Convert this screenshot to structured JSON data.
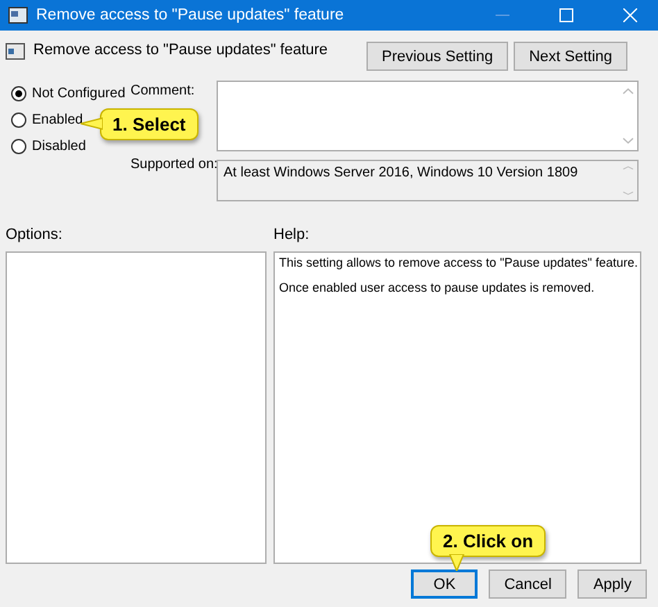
{
  "window": {
    "title": "Remove access to \"Pause updates\" feature"
  },
  "header": {
    "title": "Remove access to \"Pause updates\" feature",
    "buttons": [
      "Previous Setting",
      "Next Setting"
    ]
  },
  "state_options": [
    {
      "label": "Not Configured",
      "selected": true
    },
    {
      "label": "Enabled",
      "selected": false
    },
    {
      "label": "Disabled",
      "selected": false
    }
  ],
  "comment": {
    "label": "Comment:"
  },
  "supported_on": {
    "label": "Supported on:",
    "value": "At least Windows Server 2016, Windows 10 Version 1809"
  },
  "options": {
    "label": "Options:"
  },
  "help": {
    "label": "Help:",
    "paragraphs": [
      "This setting allows to remove access to \"Pause updates\" feature.",
      "Once enabled user access to pause updates is removed."
    ]
  },
  "buttons": [
    {
      "label": "OK",
      "focused": true
    },
    {
      "label": "Cancel",
      "focused": false
    },
    {
      "label": "Apply",
      "focused": false
    }
  ],
  "callouts": [
    {
      "text": "1. Select"
    },
    {
      "text": "2. Click on"
    }
  ]
}
